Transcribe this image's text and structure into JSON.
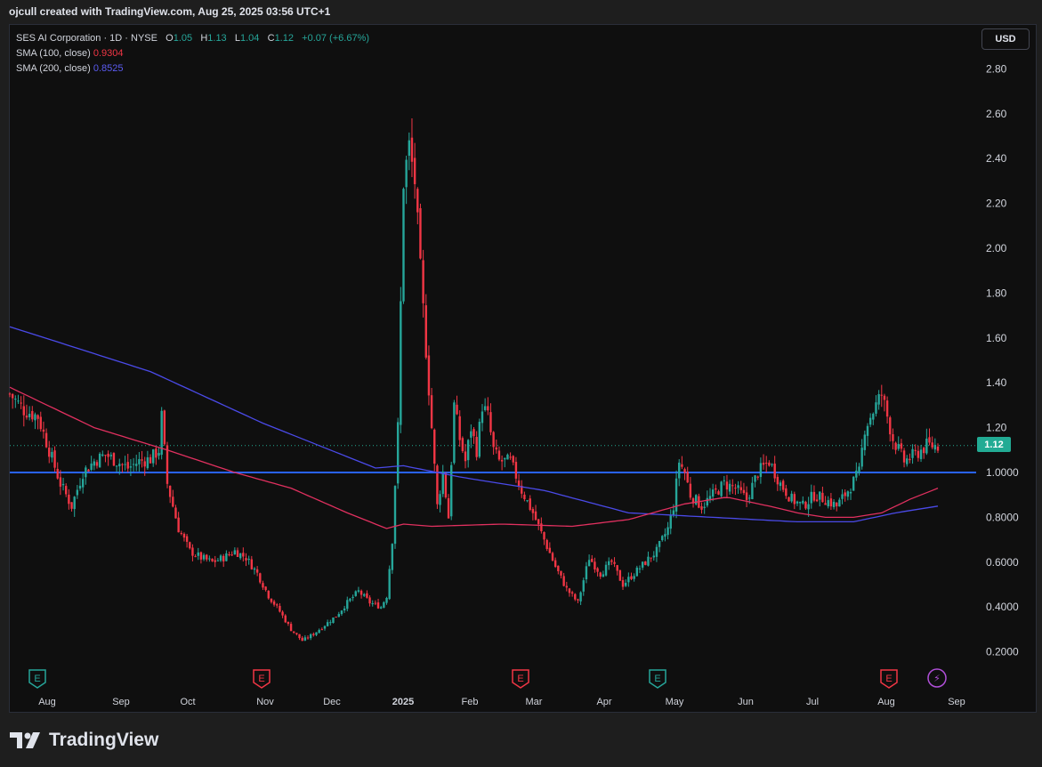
{
  "header": {
    "attribution": "ojcull created with TradingView.com, Aug 25, 2025 03:56 UTC+1"
  },
  "legend": {
    "symbol": "SES AI Corporation · 1D · NYSE",
    "o_label": "O",
    "o_value": "1.05",
    "h_label": "H",
    "h_value": "1.13",
    "l_label": "L",
    "l_value": "1.04",
    "c_label": "C",
    "c_value": "1.12",
    "change": "+0.07 (+6.67%)",
    "sma100_label": "SMA (100, close)",
    "sma100_value": "0.9304",
    "sma200_label": "SMA (200, close)",
    "sma200_value": "0.8525"
  },
  "currency_label": "USD",
  "last_price_label": "1.12",
  "footer": {
    "brand": "TradingView"
  },
  "colors": {
    "up": "#26a69a",
    "down": "#f23645",
    "sma100": "#e0305f",
    "sma200": "#4a4ae8",
    "support": "#2962ff",
    "background": "#0f0f0f"
  },
  "chart_data": {
    "type": "candlestick",
    "ylim": [
      0.15,
      2.9
    ],
    "y_ticks": [
      "2.80",
      "2.60",
      "2.40",
      "2.20",
      "2.00",
      "1.80",
      "1.60",
      "1.40",
      "1.20",
      "1.0000",
      "0.8000",
      "0.6000",
      "0.4000",
      "0.2000"
    ],
    "x_ticks": [
      "Aug",
      "Sep",
      "Oct",
      "Nov",
      "Dec",
      "2025",
      "Feb",
      "Mar",
      "Apr",
      "May",
      "Jun",
      "Jul",
      "Aug",
      "Sep"
    ],
    "horizontal_line": 1.0,
    "last_price": 1.12,
    "earnings_markers": [
      {
        "label": "E",
        "month": "Aug",
        "kind": "green"
      },
      {
        "label": "E",
        "month": "Nov",
        "kind": "red"
      },
      {
        "label": "E",
        "month": "Mar",
        "kind": "red"
      },
      {
        "label": "E",
        "month": "May",
        "kind": "green"
      },
      {
        "label": "E",
        "month": "Aug",
        "kind": "red"
      },
      {
        "label": "⚡",
        "month": "Sep",
        "kind": "purple"
      }
    ],
    "close_path": [
      [
        0,
        1.35
      ],
      [
        5,
        1.28
      ],
      [
        10,
        1.25
      ],
      [
        14,
        1.1
      ],
      [
        18,
        0.95
      ],
      [
        22,
        0.85
      ],
      [
        26,
        1.0
      ],
      [
        30,
        1.05
      ],
      [
        34,
        1.08
      ],
      [
        38,
        1.05
      ],
      [
        42,
        1.02
      ],
      [
        46,
        1.05
      ],
      [
        50,
        1.06
      ],
      [
        53,
        1.1
      ],
      [
        54,
        1.25
      ],
      [
        56,
        0.95
      ],
      [
        60,
        0.75
      ],
      [
        64,
        0.65
      ],
      [
        68,
        0.62
      ],
      [
        72,
        0.6
      ],
      [
        76,
        0.62
      ],
      [
        80,
        0.65
      ],
      [
        84,
        0.62
      ],
      [
        88,
        0.55
      ],
      [
        92,
        0.45
      ],
      [
        96,
        0.38
      ],
      [
        100,
        0.3
      ],
      [
        104,
        0.25
      ],
      [
        108,
        0.28
      ],
      [
        112,
        0.32
      ],
      [
        116,
        0.36
      ],
      [
        120,
        0.42
      ],
      [
        124,
        0.47
      ],
      [
        128,
        0.42
      ],
      [
        132,
        0.4
      ],
      [
        134,
        0.45
      ],
      [
        136,
        0.7
      ],
      [
        138,
        1.2
      ],
      [
        140,
        2.3
      ],
      [
        142,
        2.45
      ],
      [
        144,
        2.3
      ],
      [
        146,
        1.9
      ],
      [
        148,
        1.55
      ],
      [
        150,
        1.2
      ],
      [
        152,
        0.85
      ],
      [
        154,
        1.0
      ],
      [
        156,
        0.8
      ],
      [
        158,
        1.3
      ],
      [
        160,
        1.15
      ],
      [
        162,
        1.05
      ],
      [
        164,
        1.2
      ],
      [
        166,
        1.1
      ],
      [
        168,
        1.3
      ],
      [
        170,
        1.25
      ],
      [
        172,
        1.1
      ],
      [
        174,
        1.05
      ],
      [
        178,
        1.05
      ],
      [
        182,
        0.92
      ],
      [
        186,
        0.82
      ],
      [
        190,
        0.7
      ],
      [
        194,
        0.58
      ],
      [
        198,
        0.48
      ],
      [
        202,
        0.42
      ],
      [
        206,
        0.62
      ],
      [
        210,
        0.55
      ],
      [
        214,
        0.6
      ],
      [
        218,
        0.5
      ],
      [
        222,
        0.55
      ],
      [
        226,
        0.6
      ],
      [
        230,
        0.65
      ],
      [
        234,
        0.75
      ],
      [
        236,
        0.85
      ],
      [
        238,
        1.05
      ],
      [
        240,
        1.0
      ],
      [
        242,
        0.9
      ],
      [
        246,
        0.85
      ],
      [
        250,
        0.9
      ],
      [
        254,
        0.95
      ],
      [
        258,
        0.93
      ],
      [
        262,
        0.88
      ],
      [
        266,
        1.0
      ],
      [
        270,
        1.05
      ],
      [
        274,
        0.95
      ],
      [
        278,
        0.88
      ],
      [
        282,
        0.85
      ],
      [
        286,
        0.9
      ],
      [
        290,
        0.88
      ],
      [
        294,
        0.85
      ],
      [
        298,
        0.92
      ],
      [
        302,
        1.0
      ],
      [
        304,
        1.2
      ],
      [
        306,
        1.25
      ],
      [
        308,
        1.3
      ],
      [
        310,
        1.35
      ],
      [
        312,
        1.25
      ],
      [
        314,
        1.15
      ],
      [
        318,
        1.05
      ],
      [
        322,
        1.08
      ],
      [
        326,
        1.12
      ],
      [
        330,
        1.12
      ]
    ],
    "sma100_path": [
      [
        0,
        1.38
      ],
      [
        30,
        1.2
      ],
      [
        56,
        1.1
      ],
      [
        80,
        1.0
      ],
      [
        100,
        0.93
      ],
      [
        120,
        0.82
      ],
      [
        134,
        0.75
      ],
      [
        140,
        0.77
      ],
      [
        150,
        0.76
      ],
      [
        175,
        0.77
      ],
      [
        200,
        0.76
      ],
      [
        220,
        0.79
      ],
      [
        240,
        0.86
      ],
      [
        255,
        0.89
      ],
      [
        270,
        0.85
      ],
      [
        280,
        0.82
      ],
      [
        290,
        0.8
      ],
      [
        300,
        0.8
      ],
      [
        310,
        0.82
      ],
      [
        320,
        0.88
      ],
      [
        330,
        0.93
      ]
    ],
    "sma200_path": [
      [
        0,
        1.65
      ],
      [
        50,
        1.45
      ],
      [
        90,
        1.22
      ],
      [
        130,
        1.02
      ],
      [
        140,
        1.03
      ],
      [
        160,
        0.98
      ],
      [
        190,
        0.92
      ],
      [
        220,
        0.82
      ],
      [
        250,
        0.8
      ],
      [
        280,
        0.78
      ],
      [
        300,
        0.78
      ],
      [
        315,
        0.82
      ],
      [
        330,
        0.85
      ]
    ]
  }
}
